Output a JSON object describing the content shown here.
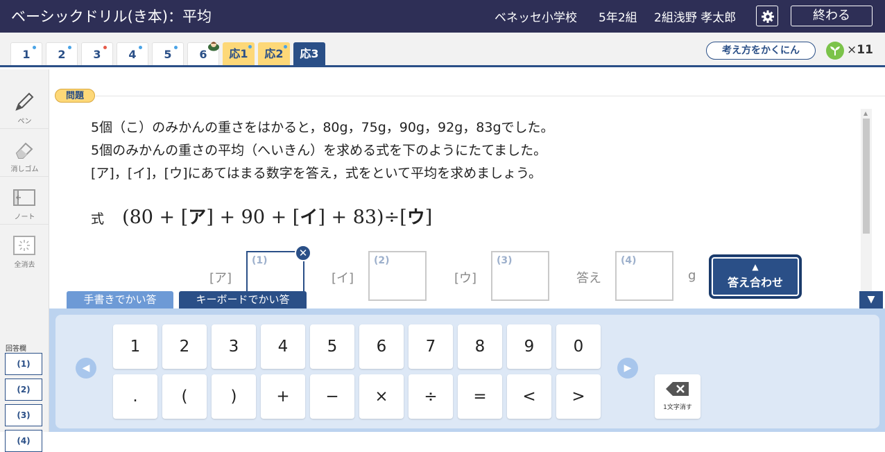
{
  "header": {
    "title": "ベーシックドリル(き本)：平均",
    "school": "ベネッセ小学校",
    "class": "5年2組",
    "student": "2組浅野 孝太郎",
    "end_label": "終わる"
  },
  "tabs": [
    {
      "label": "1",
      "dot": "blue"
    },
    {
      "label": "2",
      "dot": "blue"
    },
    {
      "label": "3",
      "dot": "red"
    },
    {
      "label": "4",
      "dot": "blue"
    },
    {
      "label": "5",
      "dot": "blue"
    },
    {
      "label": "6",
      "dot": "none"
    },
    {
      "label": "応1",
      "dot": "blue"
    },
    {
      "label": "応2",
      "dot": "blue"
    },
    {
      "label": "応3",
      "active": true
    }
  ],
  "think_label": "考え方をかくにん",
  "sprout_count": {
    "times": "×",
    "value": "11"
  },
  "tools": {
    "pen": "ペン",
    "eraser": "消しゴム",
    "note": "ノート",
    "clear": "全消去"
  },
  "answer_column": {
    "label": "回答欄",
    "slots": [
      "(1)",
      "(2)",
      "(3)",
      "(4)"
    ]
  },
  "question": {
    "badge": "問題",
    "lines": [
      "5個（こ）のみかんの重さをはかると，80g，75g，90g，92g，83gでした。",
      "5個のみかんの重さの平均（へいきん）を求める式を下のようにたてました。",
      "[ア]，[イ]，[ウ]にあてはまる数字を答え，式をといて平均を求めましょう。"
    ],
    "formula": {
      "label": "式",
      "part1": "(80 + ",
      "box_a": "ア",
      "part2": " + 90 + ",
      "box_i": "イ",
      "part3": " + 83)÷",
      "box_u": "ウ"
    }
  },
  "answers": {
    "a_label": "[ア]",
    "i_label": "[イ]",
    "u_label": "[ウ]",
    "final_label": "答え",
    "unit": "g",
    "box_numbers": [
      "(1)",
      "(2)",
      "(3)",
      "(4)"
    ]
  },
  "check_button": {
    "arrow": "▲",
    "label": "答え合わせ"
  },
  "input_modes": {
    "handwriting": "手書きでかい答",
    "keyboard": "キーボードでかい答"
  },
  "keypad": {
    "row1": [
      "1",
      "2",
      "3",
      "4",
      "5",
      "6",
      "7",
      "8",
      "9",
      "0"
    ],
    "row2": [
      ".",
      "(",
      ")",
      "+",
      "−",
      "×",
      "÷",
      "=",
      "<",
      ">"
    ],
    "backspace_label": "1文字消す"
  },
  "colors": {
    "header": "#2e2f56",
    "accent": "#2a4f87",
    "applied_tab": "#fdd878"
  }
}
